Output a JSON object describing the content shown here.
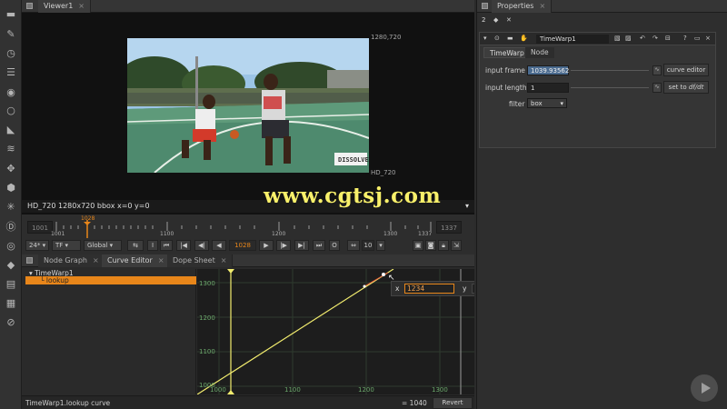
{
  "viewer": {
    "tab": "Viewer1",
    "top_right_format": "1280,720",
    "format_name": "HD_720",
    "info_line": "HD_720 1280x720  bbox  x=0 y=0",
    "image_caption": "DISSOLVE",
    "watermark": "www.cgtsj.com"
  },
  "timeline": {
    "start_frame": "1001",
    "end_frame": "1337",
    "playhead_frame": "1028",
    "tick_labels": [
      "1001",
      "1100",
      "1200",
      "1300",
      "1337"
    ],
    "fps": "24*",
    "tf": "TF",
    "global": "Global",
    "current_frame": "1028",
    "step_value": "10",
    "i_label": "I",
    "o_label": "O"
  },
  "properties": {
    "tab": "Properties",
    "count": "2",
    "node_name": "TimeWarp1",
    "tabs": [
      "TimeWarp",
      "Node"
    ],
    "input_frame_label": "input frame",
    "input_frame_value": "1039.93562",
    "input_length_label": "input length",
    "input_length_value": "1",
    "filter_label": "filter",
    "filter_value": "box",
    "curve_editor_button": "curve editor",
    "set_to_button_prefix": "set to ",
    "set_to_button_expr": "df/dt"
  },
  "bottom": {
    "tabs": [
      "Node Graph",
      "Curve Editor",
      "Dope Sheet"
    ],
    "tree": {
      "root": "TimeWarp1",
      "child": "lookup"
    },
    "graph": {
      "y_labels": [
        "1300",
        "1200",
        "1100",
        "1000"
      ],
      "x_labels": [
        "1000",
        "1100",
        "1200",
        "1300"
      ]
    },
    "point_edit": {
      "x_label": "x",
      "x_value": "1234",
      "y_label": "y",
      "y_value": "1337"
    },
    "status": {
      "path": "TimeWarp1.lookup  curve",
      "result": "= 1040",
      "revert": "Revert"
    }
  },
  "colors": {
    "accent_orange": "#e8861a",
    "curve_yellow": "#f2ec6e",
    "watermark_yellow": "#f8f06a"
  }
}
